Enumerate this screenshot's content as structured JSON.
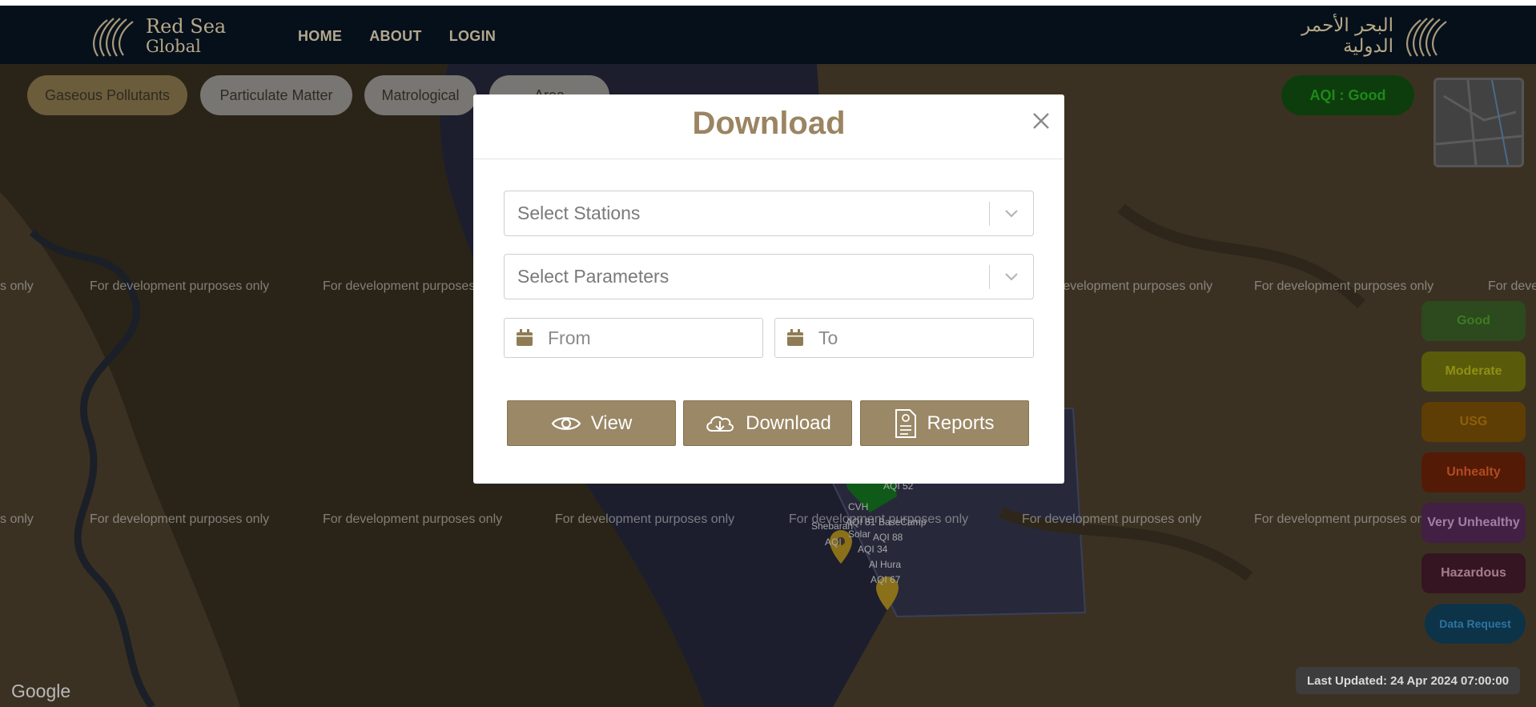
{
  "header": {
    "logo_en_line1": "Red Sea",
    "logo_en_line2": "Global",
    "logo_ar_line1": "البحر الأحمر",
    "logo_ar_line2": "الدولية",
    "nav": [
      "HOME",
      "ABOUT",
      "LOGIN"
    ]
  },
  "filters": {
    "gaseous": "Gaseous Pollutants",
    "particulate": "Particulate Matter",
    "meteorological": "Matrological",
    "area": "Area"
  },
  "aqi_status": "AQI : Good",
  "legend": [
    "Good",
    "Moderate",
    "USG",
    "Unhealty",
    "Very Unhealthy",
    "Hazardous"
  ],
  "data_request": "Data Request",
  "last_updated": "Last Updated: 24 Apr 2024 07:00:00",
  "map": {
    "watermark": "For development purposes only",
    "google": "Google",
    "markers": [
      "AQI 52",
      "CVH",
      "AQI 81",
      "Solar",
      "AQI 34",
      "Shebarah",
      "AQI",
      "BaseCamp",
      "AQI 88",
      "Al Hura",
      "AQI 67"
    ]
  },
  "modal": {
    "title": "Download",
    "stations_placeholder": "Select Stations",
    "parameters_placeholder": "Select Parameters",
    "from_placeholder": "From",
    "to_placeholder": "To",
    "view_label": "View",
    "download_label": "Download",
    "reports_label": "Reports"
  },
  "colors": {
    "header_bg": "#06101b",
    "accent_gold": "#9a8866",
    "aqi_good": "#1d8a18"
  }
}
